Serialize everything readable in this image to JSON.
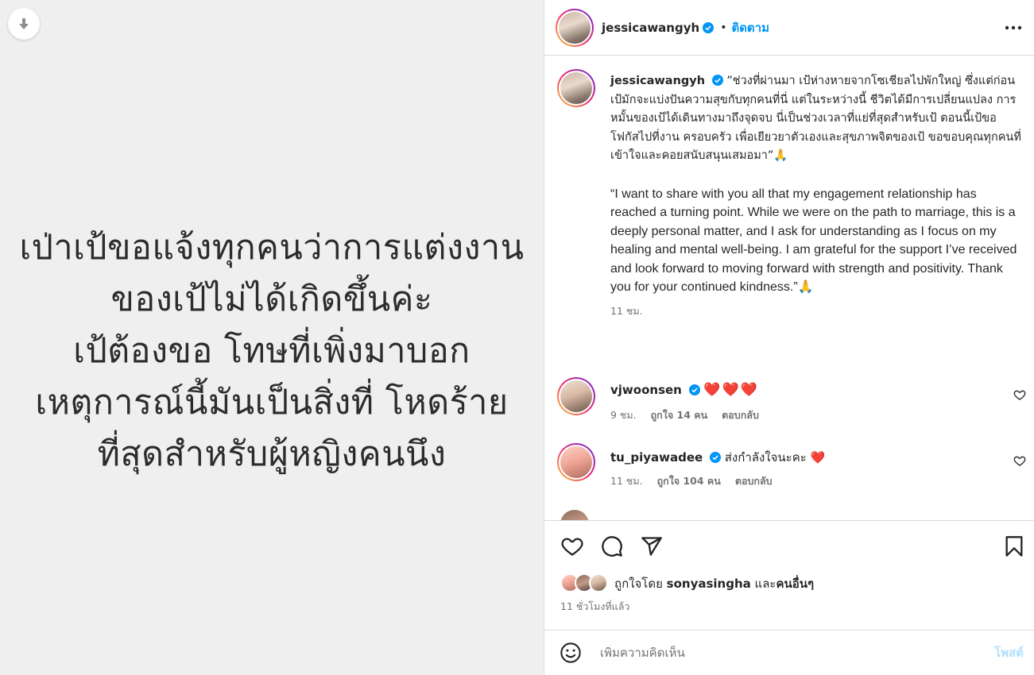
{
  "media": {
    "lines": [
      "เป่าเป้ขอแจ้งทุกคนว่าการแต่งงาน",
      "ของเป้ไม่ได้เกิดขึ้นค่ะ",
      "เป้ต้องขอ โทษที่เพิ่งมาบอก",
      "เหตุการณ์นี้มันเป็นสิ่งที่ โหดร้าย",
      "ที่สุดสำหรับผู้หญิงคนนึง"
    ],
    "download_icon": "download-icon"
  },
  "header": {
    "username": "jessicawangyh",
    "separator": "•",
    "follow_label": "ติดตาม",
    "more_icon": "more-icon"
  },
  "caption": {
    "username": "jessicawangyh",
    "text_thai": "”ช่วงที่ผ่านมา เป้ห่างหายจากโซเชียลไปพักใหญ่ ซึ่งแต่ก่อนเป้มักจะแบ่งปันความสุขกับทุกคนที่นี่ แต่ในระหว่างนี้ ชีวิตได้มีการเปลี่ยนแปลง การหมั้นของเป้ได้เดินทางมาถึงจุดจบ นี่เป็นช่วงเวลาที่แย่ที่สุดสำหรับเป้ ตอนนี้เป้ขอโฟกัสไปที่งาน ครอบครัว เพื่อเยียวยาตัวเองและสุขภาพจิตของเป้ ขอขอบคุณทุกคนที่เข้าใจและคอยสนับสนุนเสมอมา”🙏",
    "text_en": "“I want to share with you all that my engagement relationship has reached a turning point. While we were on the path to marriage, this is a deeply personal matter, and I ask for understanding as I focus on my healing and mental well-being. I am grateful for the support I’ve received and look forward to moving forward with strength and positivity. Thank you for your continued kindness.”🙏",
    "time": "11 ชม."
  },
  "comments": [
    {
      "username": "vjwoonsen",
      "text": "❤️❤️❤️",
      "time": "9 ชม.",
      "likes": "ถูกใจ 14 คน",
      "reply": "ตอบกลับ"
    },
    {
      "username": "tu_piyawadee",
      "text": "ส่งกำลังใจนะคะ ❤️",
      "time": "11 ชม.",
      "likes": "ถูกใจ 104 คน",
      "reply": "ตอบกลับ"
    }
  ],
  "likes": {
    "prefix": "ถูกใจโดย",
    "user": "sonyasingha",
    "conj": "และ",
    "others": "คนอื่นๆ"
  },
  "time_ago": "11 ชั่วโมงที่แล้ว",
  "add_comment": {
    "placeholder": "เพิ่มความคิดเห็น",
    "post_label": "โพสต์"
  },
  "colors": {
    "link_blue": "#0095f6",
    "muted": "#737373",
    "post_disabled": "#b2dffc",
    "media_bg": "#efefef"
  }
}
